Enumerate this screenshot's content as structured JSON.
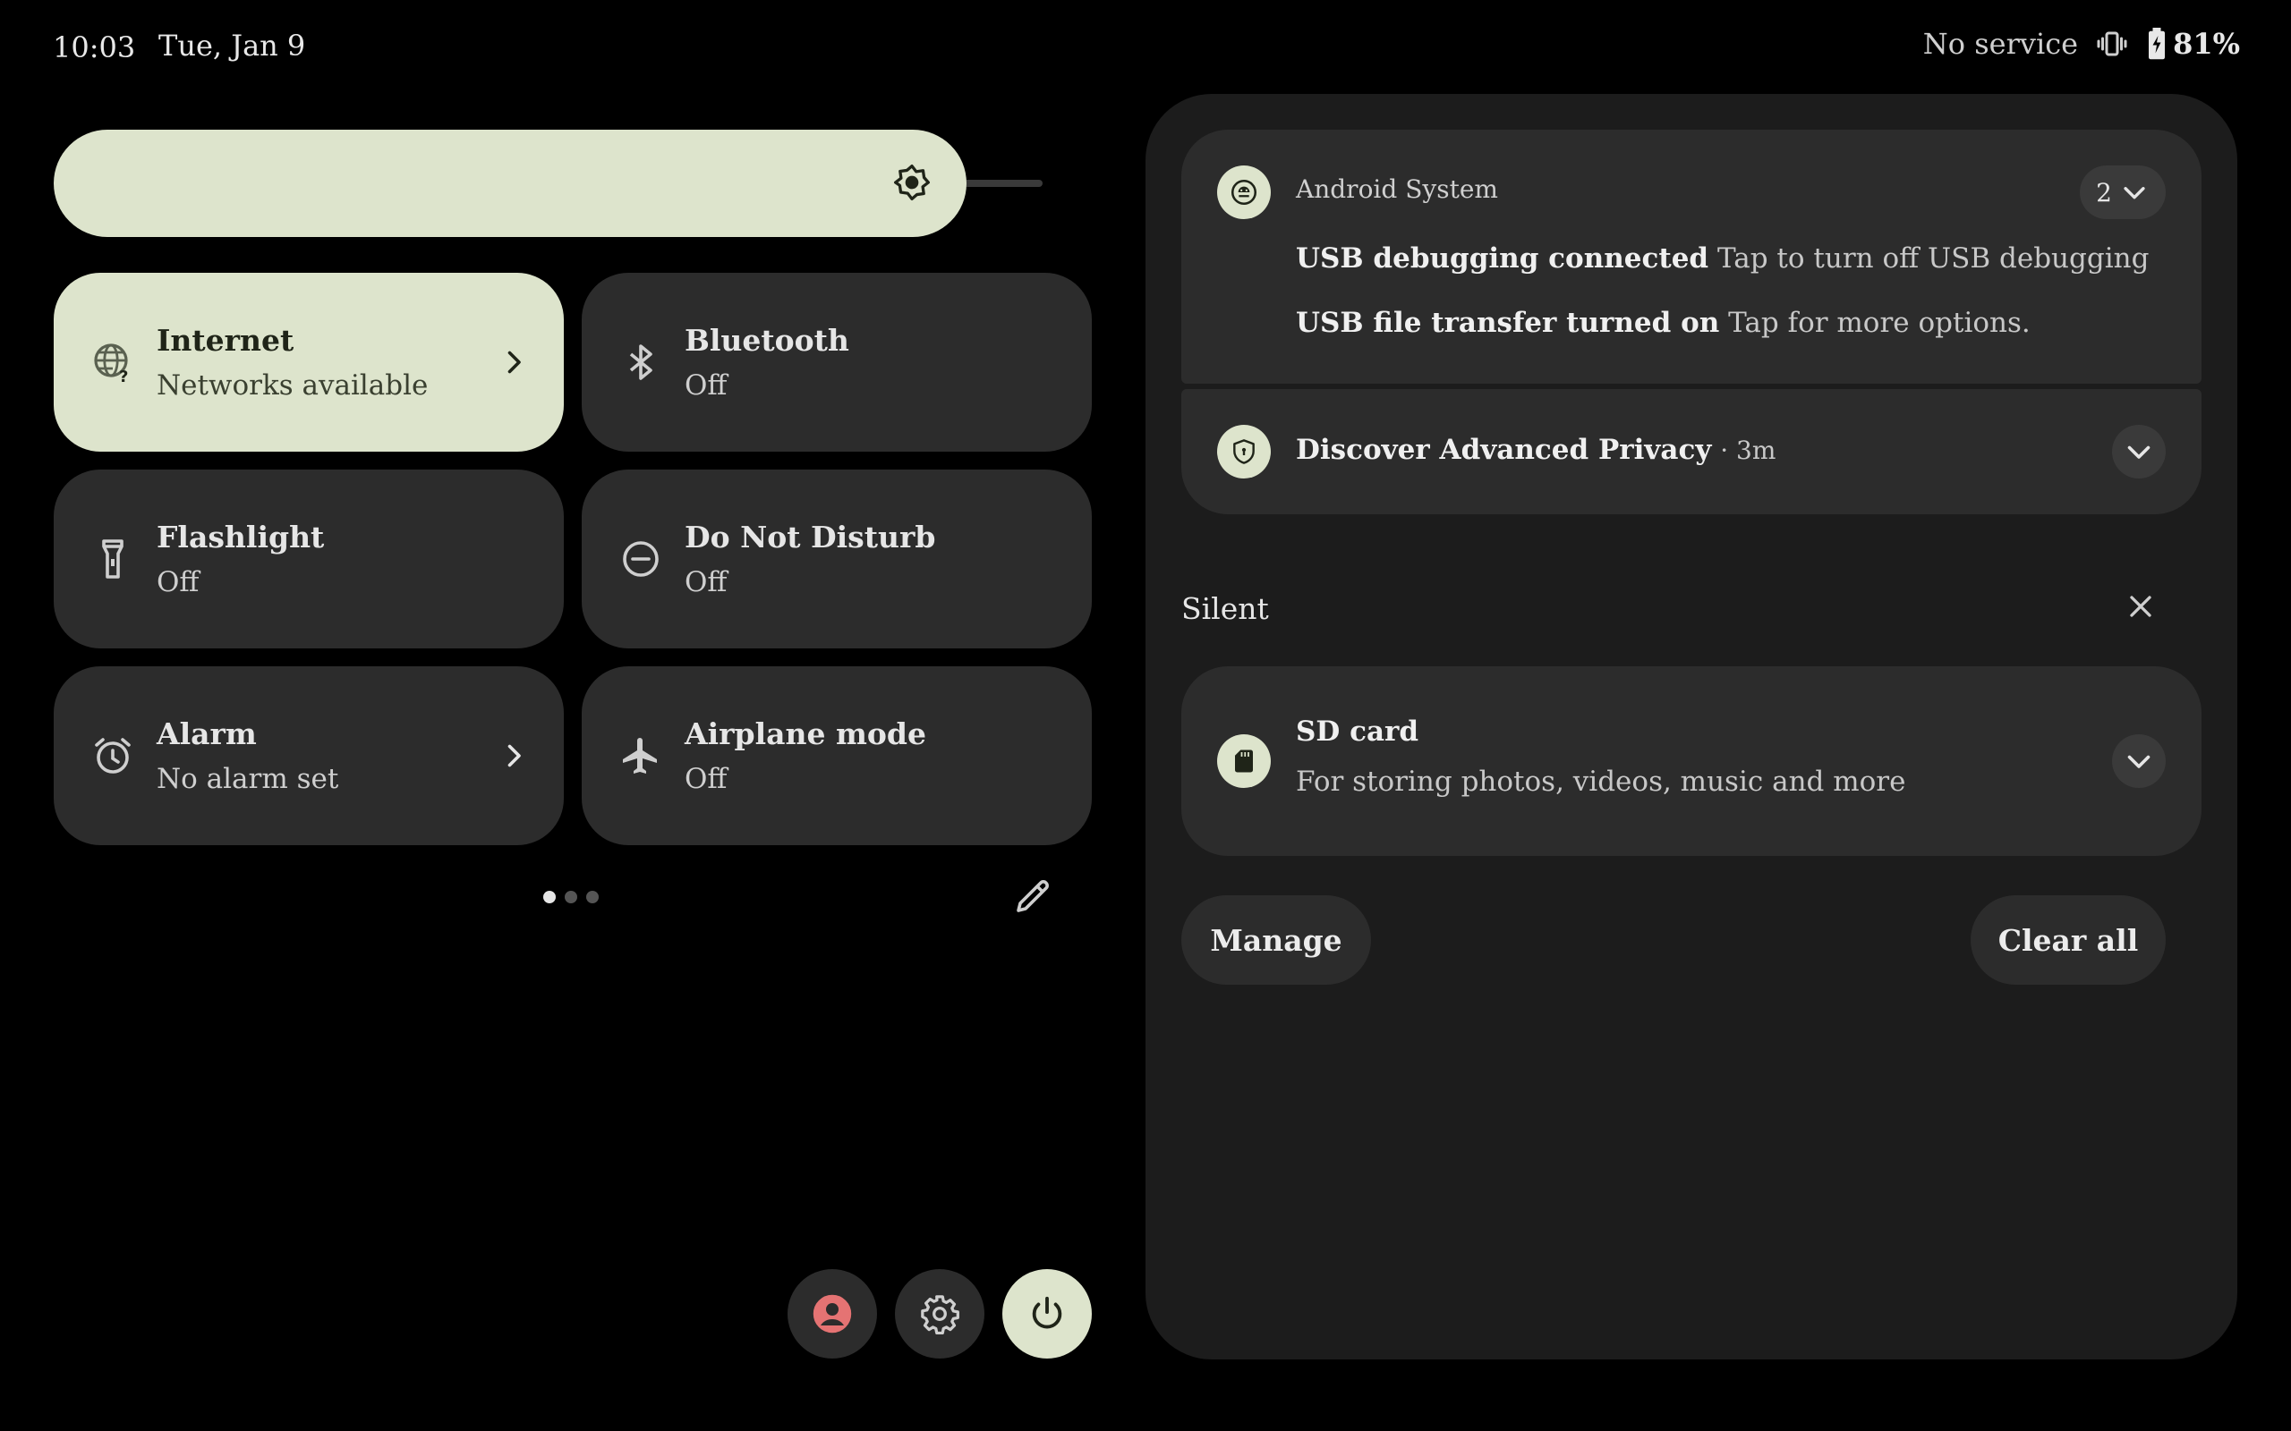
{
  "status_bar": {
    "time": "10:03",
    "date": "Tue, Jan 9",
    "network": "No service",
    "battery": "81%"
  },
  "brightness": {
    "icon": "brightness-icon",
    "level": 0.77
  },
  "tiles": [
    {
      "title": "Internet",
      "subtitle": "Networks available",
      "icon": "globe-question-icon",
      "active": true,
      "has_chevron": true
    },
    {
      "title": "Bluetooth",
      "subtitle": "Off",
      "icon": "bluetooth-icon",
      "active": false
    },
    {
      "title": "Flashlight",
      "subtitle": "Off",
      "icon": "flashlight-icon",
      "active": false
    },
    {
      "title": "Do Not Disturb",
      "subtitle": "Off",
      "icon": "do-not-disturb-icon",
      "active": false
    },
    {
      "title": "Alarm",
      "subtitle": "No alarm set",
      "icon": "alarm-icon",
      "active": false,
      "has_chevron": true
    },
    {
      "title": "Airplane mode",
      "subtitle": "Off",
      "icon": "airplane-icon",
      "active": false
    }
  ],
  "page_indicator": {
    "pages": 3,
    "current": 1
  },
  "notifications": {
    "android_system": {
      "app_name": "Android System",
      "count": "2",
      "items": [
        {
          "title": "USB debugging connected",
          "text": "Tap to turn off USB debugging"
        },
        {
          "title": "USB file transfer turned on",
          "text": "Tap for more options."
        }
      ]
    },
    "privacy": {
      "title": "Discover Advanced Privacy",
      "time": "· 3m"
    },
    "silent_section": {
      "label": "Silent"
    },
    "sd_card": {
      "title": "SD card",
      "text": "For storing photos, videos, music and more"
    },
    "actions": {
      "manage": "Manage",
      "clear_all": "Clear all"
    }
  },
  "colors": {
    "accent": "#dde4cc",
    "tile": "#2c2c2c",
    "panel": "#1c1c1c",
    "user_icon": "#e57373"
  }
}
